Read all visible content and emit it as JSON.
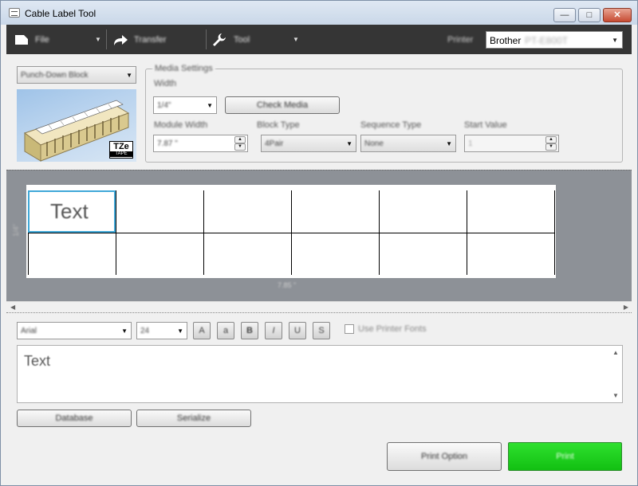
{
  "window": {
    "title": "Cable Label Tool",
    "minimize": "—",
    "maximize": "□",
    "close": "✕"
  },
  "toolbar": {
    "file": "File",
    "transfer": "Transfer",
    "tool": "Tool",
    "printer_label": "Printer",
    "printer_value": "Brother",
    "printer_model": "PT-E800T"
  },
  "application_select": "Punch-Down Block",
  "media_settings": {
    "legend": "Media Settings",
    "width_label": "Width",
    "width_value": "1/4\"",
    "check_media": "Check Media",
    "module_width_label": "Module Width",
    "module_width_value": "7.87 \"",
    "block_type_label": "Block Type",
    "block_type_value": "4Pair",
    "sequence_type_label": "Sequence Type",
    "sequence_type_value": "None",
    "start_value_label": "Start Value",
    "start_value_value": "1"
  },
  "image_logo": {
    "main": "TZe",
    "sub": "TAPE"
  },
  "canvas": {
    "cell_text": "Text",
    "ruler_vertical": "1/4\"",
    "ruler_horizontal": "7.85 \""
  },
  "format": {
    "font": "Arial",
    "size": "24",
    "btn_grow": "A",
    "btn_shrink": "a",
    "btn_bold": "B",
    "btn_italic": "I",
    "btn_underline": "U",
    "btn_strike": "S",
    "use_printer_fonts": "Use Printer Fonts"
  },
  "text_input_value": "Text",
  "buttons": {
    "database": "Database",
    "serialize": "Serialize",
    "print_option": "Print Option",
    "print": "Print"
  },
  "colors": {
    "print": "#1fd11f",
    "toolbar": "#353535",
    "selection": "#3fa8d8"
  }
}
